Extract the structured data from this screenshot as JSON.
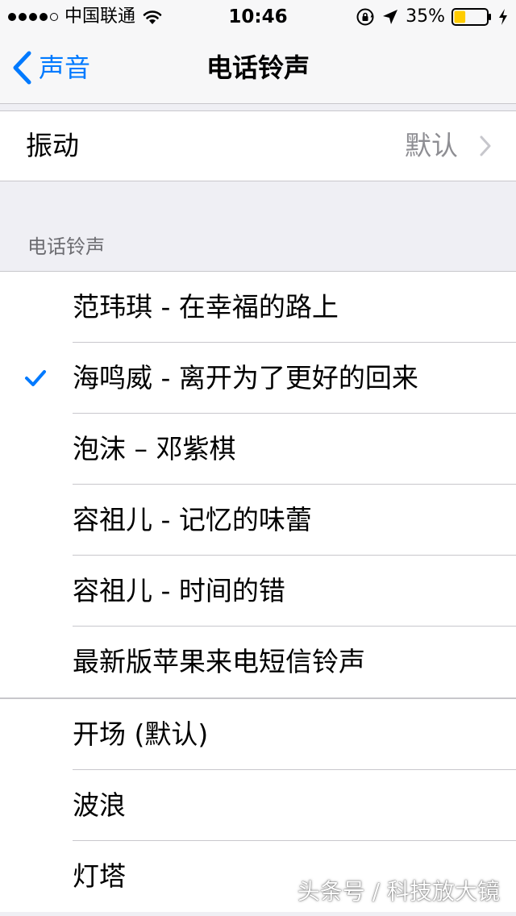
{
  "status_bar": {
    "signal_bars_filled": 4,
    "signal_bars_total": 5,
    "carrier": "中国联通",
    "wifi_icon": "wifi-icon",
    "time": "10:46",
    "orientation_lock_icon": "orientation-lock-icon",
    "location_icon": "location-arrow-icon",
    "battery_percent_text": "35%",
    "battery_level": 0.35,
    "battery_fill_color": "#ffcc00",
    "charging_icon": "charging-bolt-icon"
  },
  "nav": {
    "back_label": "声音",
    "back_icon": "chevron-left-icon",
    "title": "电话铃声",
    "accent_color": "#007aff"
  },
  "vibration": {
    "label": "振动",
    "value": "默认",
    "disclosure_icon": "chevron-right-icon"
  },
  "section_header": "电话铃声",
  "custom_ringtones": [
    {
      "label": "范玮琪 - 在幸福的路上",
      "selected": false
    },
    {
      "label": "海鸣威 - 离开为了更好的回来",
      "selected": true
    },
    {
      "label": "泡沫 – 邓紫棋",
      "selected": false
    },
    {
      "label": "容祖儿 - 记忆的味蕾",
      "selected": false
    },
    {
      "label": "容祖儿 - 时间的错",
      "selected": false
    },
    {
      "label": "最新版苹果来电短信铃声",
      "selected": false
    }
  ],
  "builtin_ringtones": [
    {
      "label": "开场 (默认)",
      "selected": false
    },
    {
      "label": "波浪",
      "selected": false
    },
    {
      "label": "灯塔",
      "selected": false
    }
  ],
  "watermark": "头条号 / 科技放大镜"
}
